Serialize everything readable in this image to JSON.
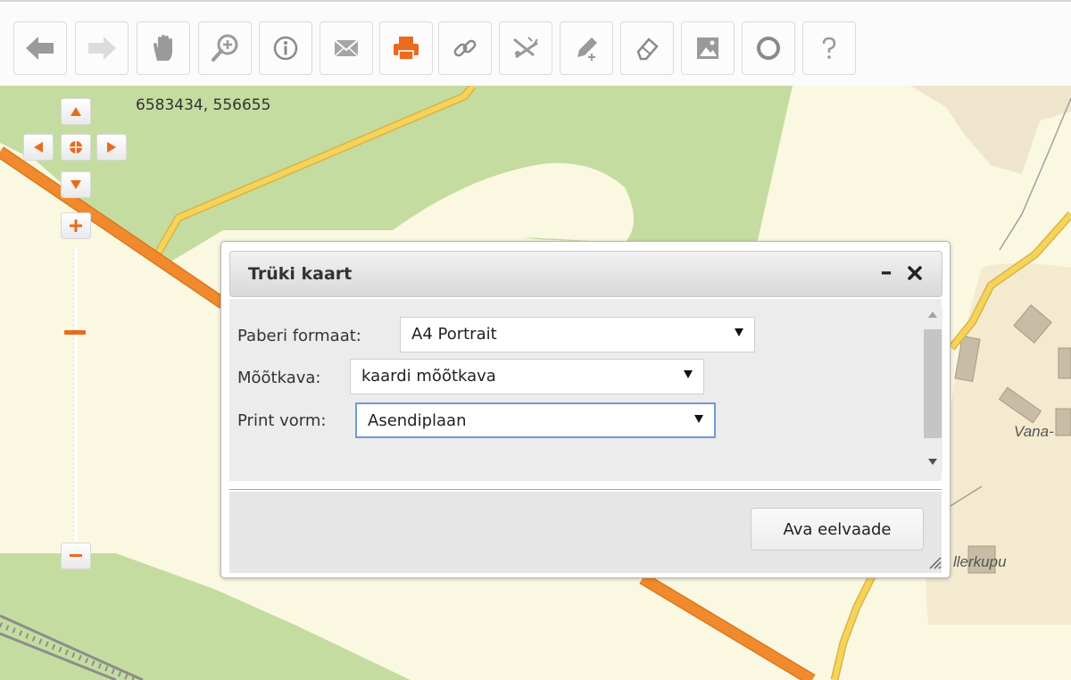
{
  "toolbar": {
    "buttons": [
      {
        "name": "back-arrow-icon"
      },
      {
        "name": "forward-arrow-icon"
      },
      {
        "name": "pan-hand-icon"
      },
      {
        "name": "zoom-in-magnifier-icon"
      },
      {
        "name": "info-icon"
      },
      {
        "name": "mail-envelope-icon"
      },
      {
        "name": "printer-icon"
      },
      {
        "name": "link-icon"
      },
      {
        "name": "measure-icon"
      },
      {
        "name": "draw-pencil-icon"
      },
      {
        "name": "eraser-icon"
      },
      {
        "name": "image-icon"
      },
      {
        "name": "circle-icon"
      },
      {
        "name": "help-question-icon"
      }
    ],
    "colors": {
      "icon": "#9a9a9a",
      "active": "#e86b1f"
    }
  },
  "map": {
    "coordinates": "6583434, 556655",
    "labels": {
      "place_1": "Vana-",
      "place_2": "llerkupu"
    },
    "colors": {
      "forest": "#c5dca0",
      "land": "#fbf8e2",
      "main_road": "#f08a2c",
      "minor_road": "#f6d45a",
      "building": "#c9bca6"
    }
  },
  "dialog": {
    "title": "Trüki kaart",
    "minimize_symbol": "–",
    "fields": {
      "paper_format": {
        "label": "Paberi formaat:",
        "value": "A4 Portrait"
      },
      "scale": {
        "label": "Mõõtkava:",
        "value": "kaardi mõõtkava"
      },
      "print_form": {
        "label": "Print vorm:",
        "value": "Asendiplaan"
      }
    },
    "preview_button": "Ava eelvaade"
  }
}
